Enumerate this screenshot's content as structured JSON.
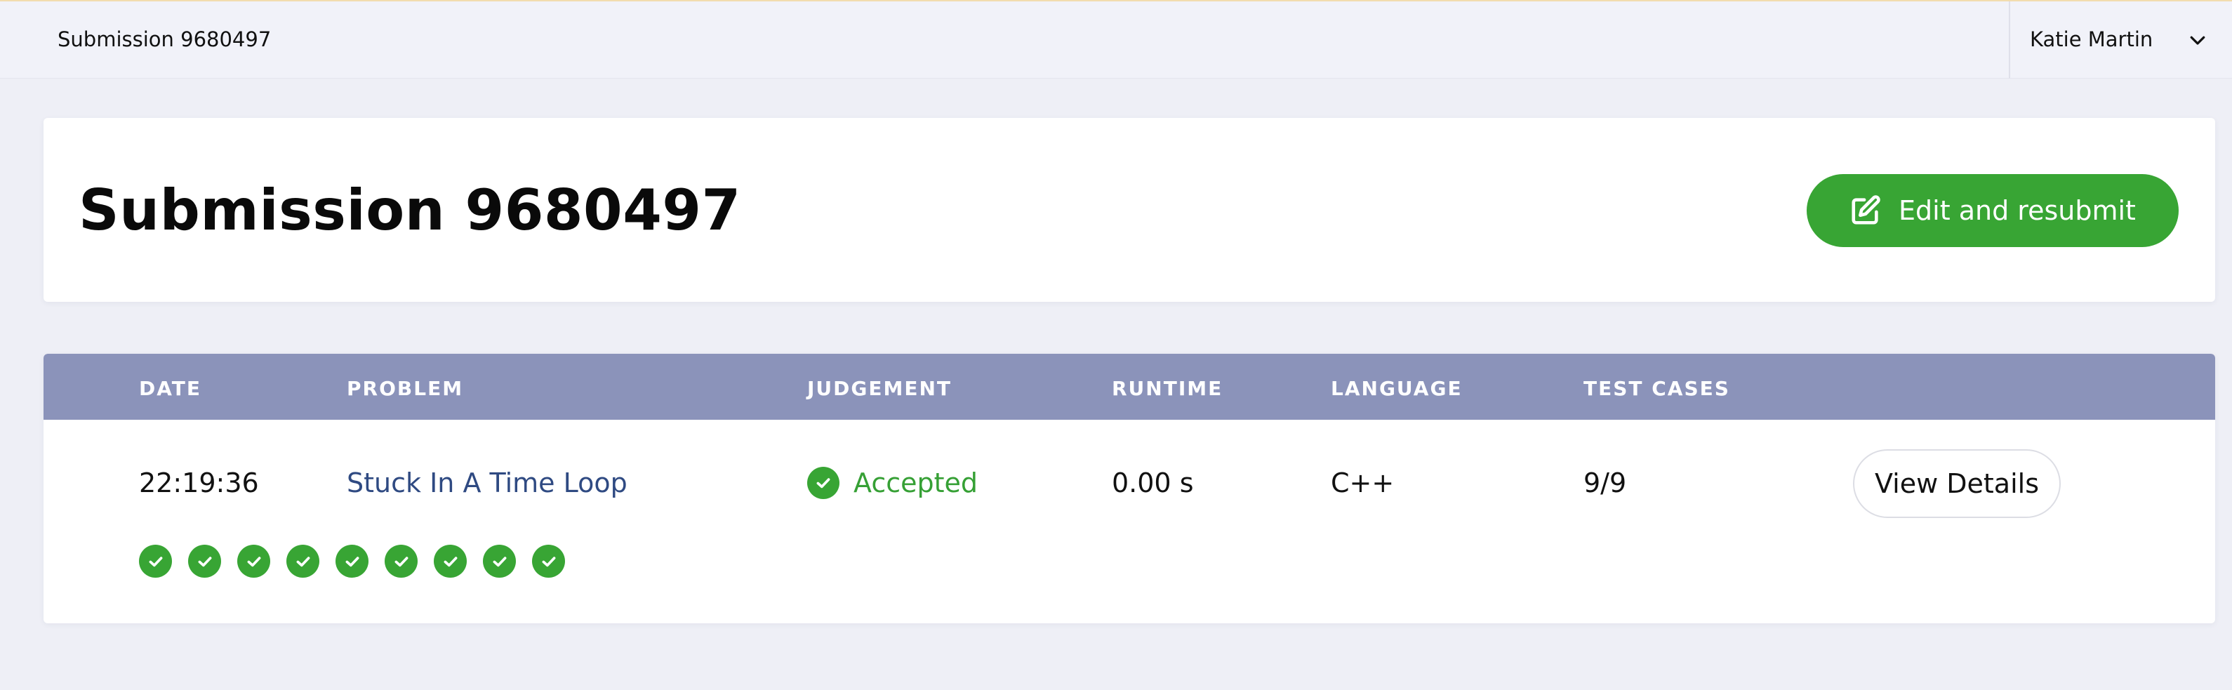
{
  "topbar": {
    "breadcrumb": "Submission 9680497",
    "user_name": "Katie Martin",
    "user_menu_icon": "chevron-down-icon"
  },
  "header": {
    "title": "Submission 9680497",
    "resubmit_label": "Edit and resubmit",
    "resubmit_icon": "edit-icon"
  },
  "table": {
    "columns": [
      "DATE",
      "PROBLEM",
      "JUDGEMENT",
      "RUNTIME",
      "LANGUAGE",
      "TEST CASES"
    ],
    "row": {
      "date": "22:19:36",
      "problem": "Stuck In A Time Loop",
      "judgement": "Accepted",
      "runtime": "0.00 s",
      "language": "C++",
      "test_cases": "9/9",
      "details_label": "View Details"
    },
    "test_case_results": [
      "accepted",
      "accepted",
      "accepted",
      "accepted",
      "accepted",
      "accepted",
      "accepted",
      "accepted",
      "accepted"
    ]
  },
  "colors": {
    "accent_green": "#38a534",
    "table_header": "#8b93ba",
    "link": "#2f4a82"
  }
}
